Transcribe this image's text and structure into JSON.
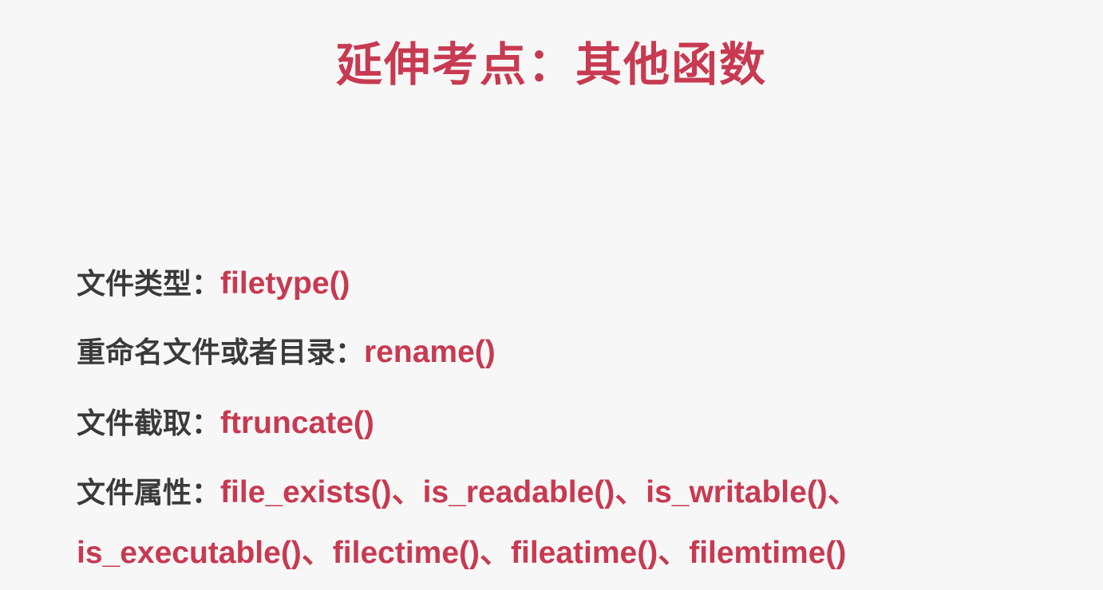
{
  "title": "延伸考点：其他函数",
  "separator": "：",
  "items": [
    {
      "label": "文件类型",
      "value": "filetype()"
    },
    {
      "label": "重命名文件或者目录",
      "value": "rename()"
    },
    {
      "label": "文件截取",
      "value": "ftruncate()"
    },
    {
      "label": "文件属性",
      "value": "file_exists()、is_readable()、is_writable()、"
    }
  ],
  "continuation": "is_executable()、filectime()、fileatime()、filemtime()"
}
